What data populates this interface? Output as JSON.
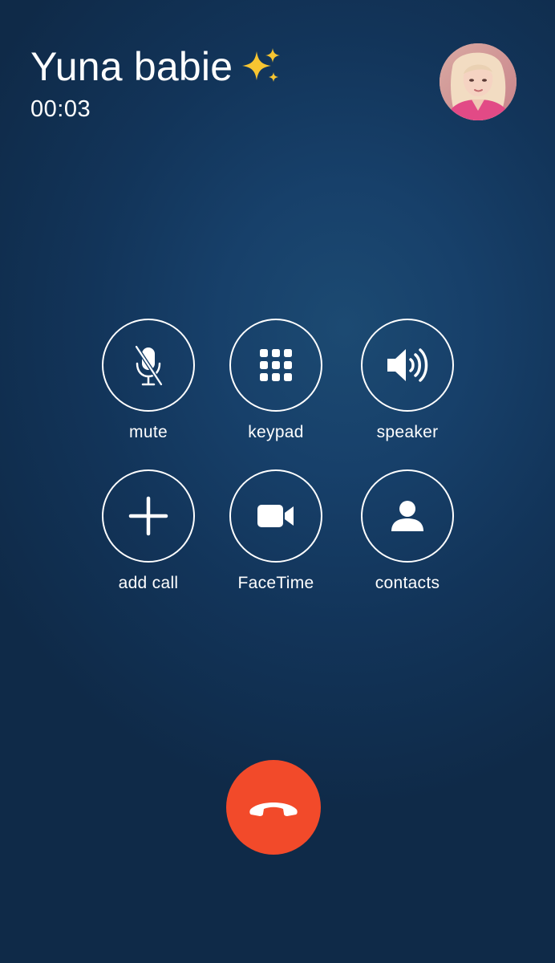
{
  "call": {
    "contact_name": "Yuna babie",
    "name_emoji_icon": "sparkles-icon",
    "duration": "00:03"
  },
  "avatar": {
    "icon": "contact-photo"
  },
  "controls": [
    {
      "id": "mute",
      "label": "mute",
      "icon": "microphone-slash-icon"
    },
    {
      "id": "keypad",
      "label": "keypad",
      "icon": "keypad-grid-icon"
    },
    {
      "id": "speaker",
      "label": "speaker",
      "icon": "speaker-wave-icon"
    },
    {
      "id": "add-call",
      "label": "add call",
      "icon": "plus-icon"
    },
    {
      "id": "facetime",
      "label": "FaceTime",
      "icon": "video-camera-icon"
    },
    {
      "id": "contacts",
      "label": "contacts",
      "icon": "person-icon"
    }
  ],
  "end_call": {
    "icon": "phone-hangup-icon"
  },
  "colors": {
    "background": "#17406a",
    "end_call": "#f24a2a",
    "foreground": "#ffffff",
    "sparkle": "#f7c531"
  }
}
